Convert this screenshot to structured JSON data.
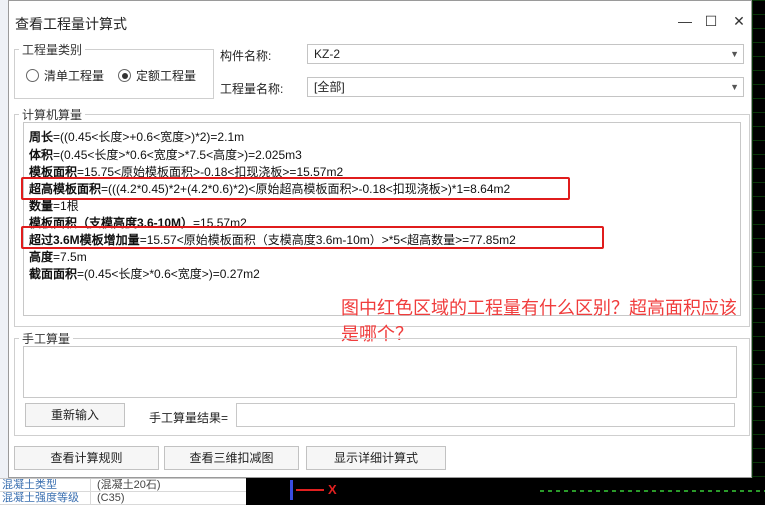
{
  "dialog": {
    "title": "查看工程量计算式",
    "window_buttons": {
      "minimize": "—",
      "maximize": "☐",
      "close": "✕"
    }
  },
  "quantity_type": {
    "legend": "工程量类别",
    "options": [
      {
        "label": "清单工程量",
        "selected": false
      },
      {
        "label": "定额工程量",
        "selected": true
      }
    ]
  },
  "component": {
    "label": "构件名称:",
    "value": "KZ-2"
  },
  "quantity_name": {
    "label": "工程量名称:",
    "value": "[全部]"
  },
  "computer_calc": {
    "legend": "计算机算量",
    "lines": [
      {
        "name": "周长",
        "expr": "=((0.45<长度>+0.6<宽度>)*2)=2.1m"
      },
      {
        "name": "体积",
        "expr": "=(0.45<长度>*0.6<宽度>*7.5<高度>)=2.025m3"
      },
      {
        "name": "模板面积",
        "expr": "=15.75<原始模板面积>-0.18<扣现浇板>=15.57m2"
      },
      {
        "name": "超高模板面积",
        "expr": "=(((4.2*0.45)*2+(4.2*0.6)*2)<原始超高模板面积>-0.18<扣现浇板>)*1=8.64m2"
      },
      {
        "name": "数量",
        "expr": "=1根"
      },
      {
        "name": "模板面积（支模高度3.6-10M）",
        "expr": "=15.57m2"
      },
      {
        "name": "超过3.6M模板增加量",
        "expr": "=15.57<原始模板面积（支模高度3.6m-10m）>*5<超高数量>=77.85m2"
      },
      {
        "name": "高度",
        "expr": "=7.5m"
      },
      {
        "name": "截面面积",
        "expr": "=(0.45<长度>*0.6<宽度>)=0.27m2"
      }
    ]
  },
  "annotation": {
    "text": "图中红色区域的工程量有什么区别？超高面积应该是哪个？",
    "color": "#f03c3c"
  },
  "manual_calc": {
    "legend": "手工算量",
    "reenter_button": "重新输入",
    "result_label": "手工算量结果="
  },
  "bottom_buttons": {
    "rules": "查看计算规则",
    "view3d": "查看三维扣减图",
    "detail": "显示详细计算式"
  },
  "background": {
    "table_rows": [
      {
        "col1": "混凝土类型",
        "col2": "(混凝土20石)"
      },
      {
        "col1": "混凝土强度等级",
        "col2": "(C35)"
      }
    ],
    "axis_label": "X"
  },
  "colors": {
    "highlight": "#e01c1c",
    "cad_grid": "#2a9a2a"
  }
}
